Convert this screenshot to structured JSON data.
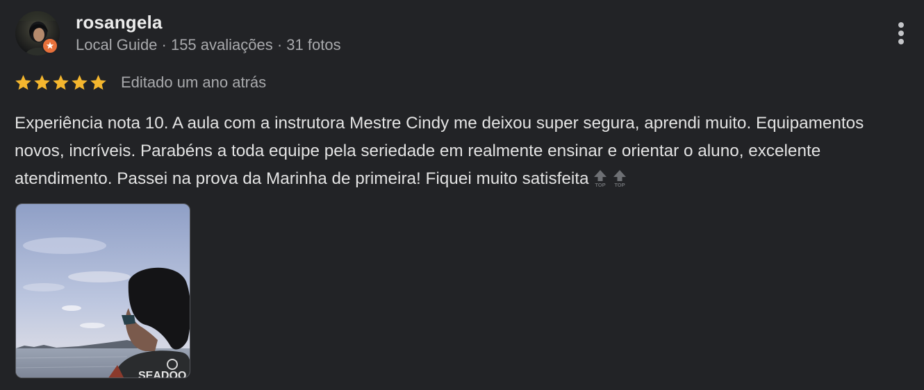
{
  "review": {
    "author": {
      "name": "rosangela",
      "meta": "Local Guide · 155 avaliações · 31 fotos"
    },
    "rating": 5,
    "edited_label": "Editado um ano atrás",
    "text": "Experiência nota 10. A aula com a instrutora Mestre Cindy me deixou super segura, aprendi muito. Equipamentos novos, incríveis. Parabéns a toda equipe pela seriedade em realmente ensinar e orientar o aluno, excelente atendimento. Passei na prova da Marinha de primeira! Fiquei muito satisfeita",
    "trailing_emoji": [
      "top-arrow-icon",
      "top-arrow-icon"
    ],
    "photo_caption_text": "SEADOO",
    "colors": {
      "background": "#222326",
      "star": "#f4b62e",
      "badge": "#e8713b",
      "muted_text": "#a9aaad"
    }
  }
}
